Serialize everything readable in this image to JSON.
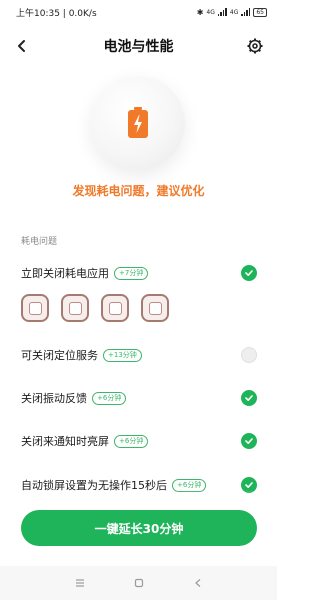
{
  "status_bar": {
    "time": "上午10:35 | 0.0K/s",
    "network_1": "4G",
    "network_2": "4G",
    "battery": "65"
  },
  "header": {
    "title": "电池与性能",
    "back_icon": "chevron-left-icon",
    "settings_icon": "gear-icon"
  },
  "hero": {
    "icon": "battery-charging-icon",
    "message": "发现耗电问题，建议优化",
    "accent_color": "#f07a2a"
  },
  "section": {
    "label": "耗电问题"
  },
  "items": [
    {
      "label": "立即关闭耗电应用",
      "badge": "+7分钟",
      "checked": true
    },
    {
      "label": "可关闭定位服务",
      "badge": "+13分钟",
      "checked": false
    },
    {
      "label": "关闭振动反馈",
      "badge": "+6分钟",
      "checked": true
    },
    {
      "label": "关闭来通知时亮屏",
      "badge": "+6分钟",
      "checked": true
    },
    {
      "label": "自动锁屏设置为无操作15秒后",
      "badge": "+6分钟",
      "checked": true
    }
  ],
  "apps": [
    "app-icon",
    "app-icon",
    "app-icon",
    "app-icon"
  ],
  "cta": {
    "label": "一键延长30分钟",
    "color": "#1fb45a"
  },
  "nav": {
    "menu_icon": "menu-icon",
    "home_icon": "home-icon",
    "back_icon": "back-triangle-icon"
  }
}
